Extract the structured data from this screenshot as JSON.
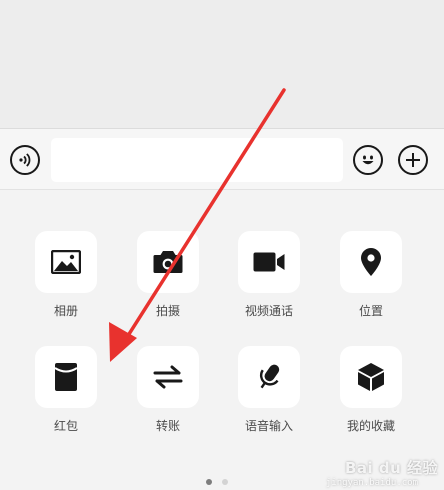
{
  "input_bar": {
    "voice_icon": "voice-wave-icon",
    "text_value": "",
    "emoji_icon": "emoji-smile-icon",
    "plus_icon": "plus-icon"
  },
  "panel": {
    "items": [
      {
        "label": "相册",
        "icon": "photo-album-icon"
      },
      {
        "label": "拍摄",
        "icon": "camera-icon"
      },
      {
        "label": "视频通话",
        "icon": "video-call-icon"
      },
      {
        "label": "位置",
        "icon": "location-pin-icon"
      },
      {
        "label": "红包",
        "icon": "red-packet-icon"
      },
      {
        "label": "转账",
        "icon": "transfer-icon"
      },
      {
        "label": "语音输入",
        "icon": "microphone-icon"
      },
      {
        "label": "我的收藏",
        "icon": "favorites-box-icon"
      }
    ],
    "page_indicator": {
      "current": 1,
      "total": 2
    }
  },
  "annotation": {
    "arrow_color": "#e8322e"
  },
  "watermark": {
    "main": "Bai du 经验",
    "sub": "jingyan.baidu.com"
  }
}
